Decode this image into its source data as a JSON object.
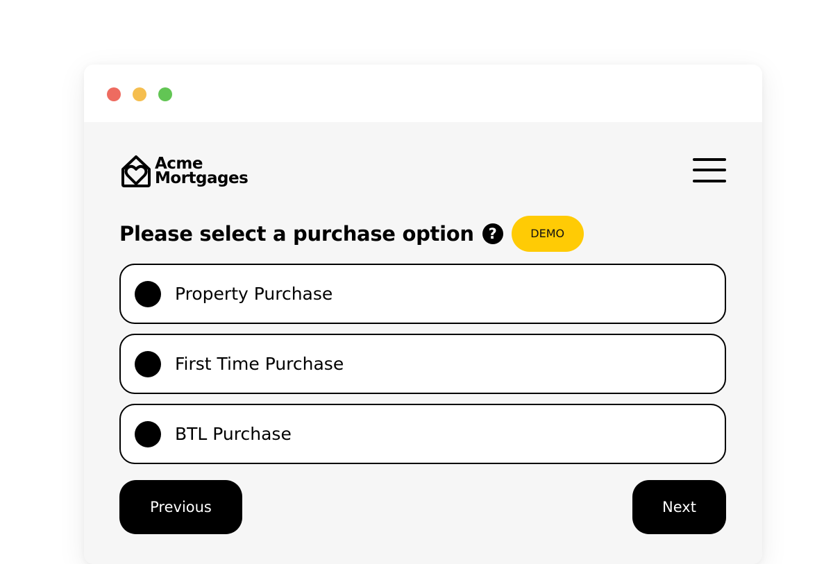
{
  "window": {
    "controls": [
      "close",
      "minimize",
      "maximize"
    ]
  },
  "logo": {
    "line1": "Acme",
    "line2": "Mortgages",
    "icon": "house-heart-icon"
  },
  "menu": {
    "icon": "hamburger-menu-icon"
  },
  "question": {
    "title": "Please select a purchase option",
    "help_icon_glyph": "?",
    "badge": "DEMO"
  },
  "options": [
    {
      "label": "Property Purchase"
    },
    {
      "label": "First Time Purchase"
    },
    {
      "label": "BTL Purchase"
    }
  ],
  "navigation": {
    "previous_label": "Previous",
    "next_label": "Next"
  },
  "colors": {
    "badge": "#ffcb05",
    "close": "#ee6b60",
    "minimize": "#f5be4f",
    "maximize": "#62c554",
    "content_background": "#f6f6f6"
  }
}
